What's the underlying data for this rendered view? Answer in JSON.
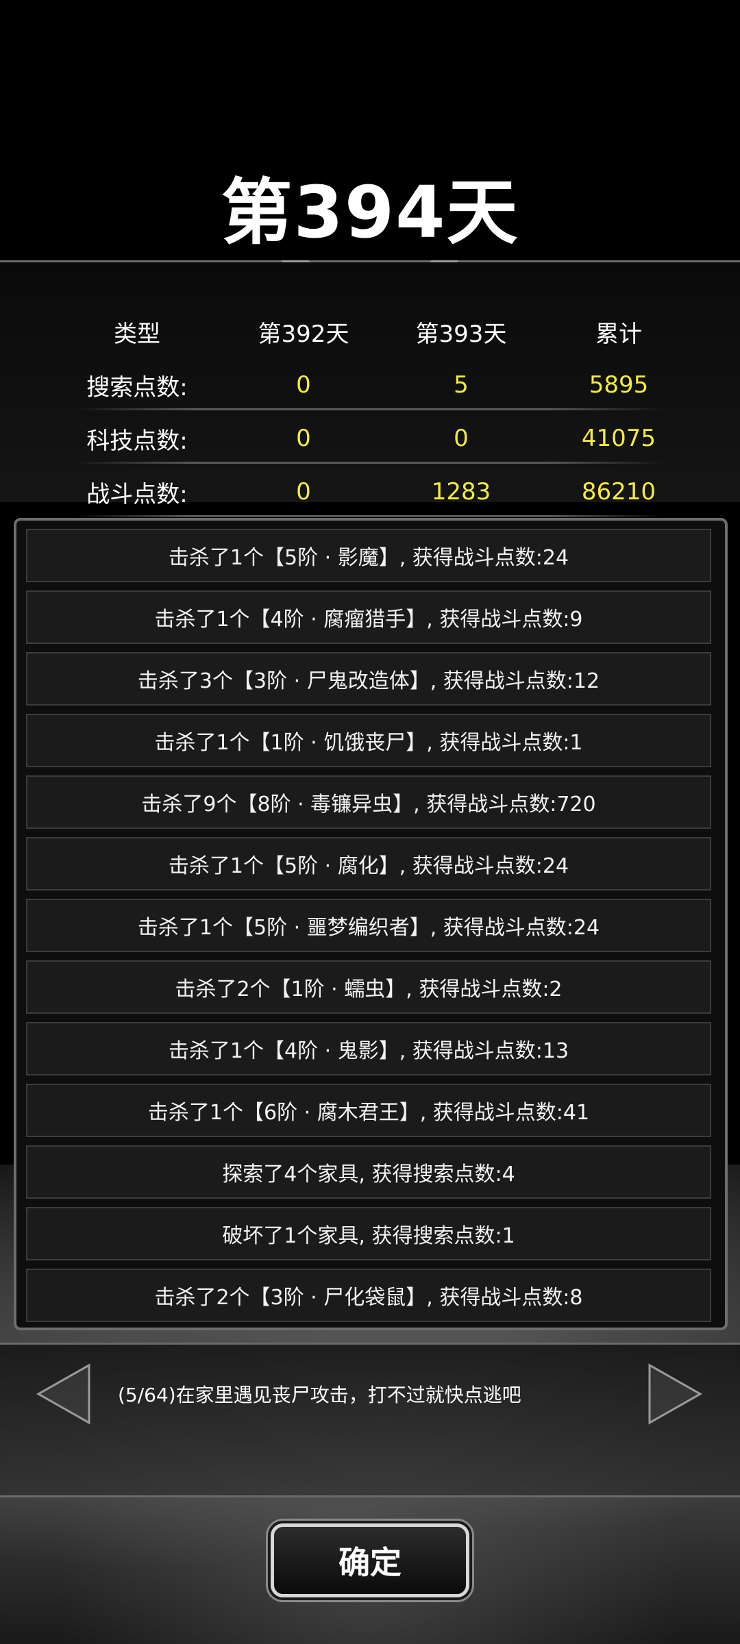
{
  "title": "第394天",
  "stats": {
    "headers": [
      "类型",
      "第392天",
      "第393天",
      "累计"
    ],
    "rows": [
      {
        "label": "搜索点数:",
        "d392": "0",
        "d393": "5",
        "total": "5895"
      },
      {
        "label": "科技点数:",
        "d392": "0",
        "d393": "0",
        "total": "41075"
      },
      {
        "label": "战斗点数:",
        "d392": "0",
        "d393": "1283",
        "total": "86210"
      }
    ]
  },
  "log": [
    "击杀了1个【5阶 · 影魔】, 获得战斗点数:24",
    "击杀了1个【4阶 · 腐瘤猎手】, 获得战斗点数:9",
    "击杀了3个【3阶 · 尸鬼改造体】, 获得战斗点数:12",
    "击杀了1个【1阶 · 饥饿丧尸】, 获得战斗点数:1",
    "击杀了9个【8阶 · 毒镰异虫】, 获得战斗点数:720",
    "击杀了1个【5阶 · 腐化】, 获得战斗点数:24",
    "击杀了1个【5阶 · 噩梦编织者】, 获得战斗点数:24",
    "击杀了2个【1阶 · 蠕虫】, 获得战斗点数:2",
    "击杀了1个【4阶 · 鬼影】, 获得战斗点数:13",
    "击杀了1个【6阶 · 腐木君王】, 获得战斗点数:41",
    "探索了4个家具, 获得搜索点数:4",
    "破坏了1个家具, 获得搜索点数:1",
    "击杀了2个【3阶 · 尸化袋鼠】, 获得战斗点数:8"
  ],
  "tip": {
    "text": "(5/64)在家里遇见丧尸攻击，打不过就快点逃吧",
    "prev_icon": "triangle-left-icon",
    "next_icon": "triangle-right-icon"
  },
  "confirm_label": "确定",
  "colors": {
    "highlight": "#f4ec3c",
    "frame": "#6e6e6e",
    "background": "#000000"
  }
}
